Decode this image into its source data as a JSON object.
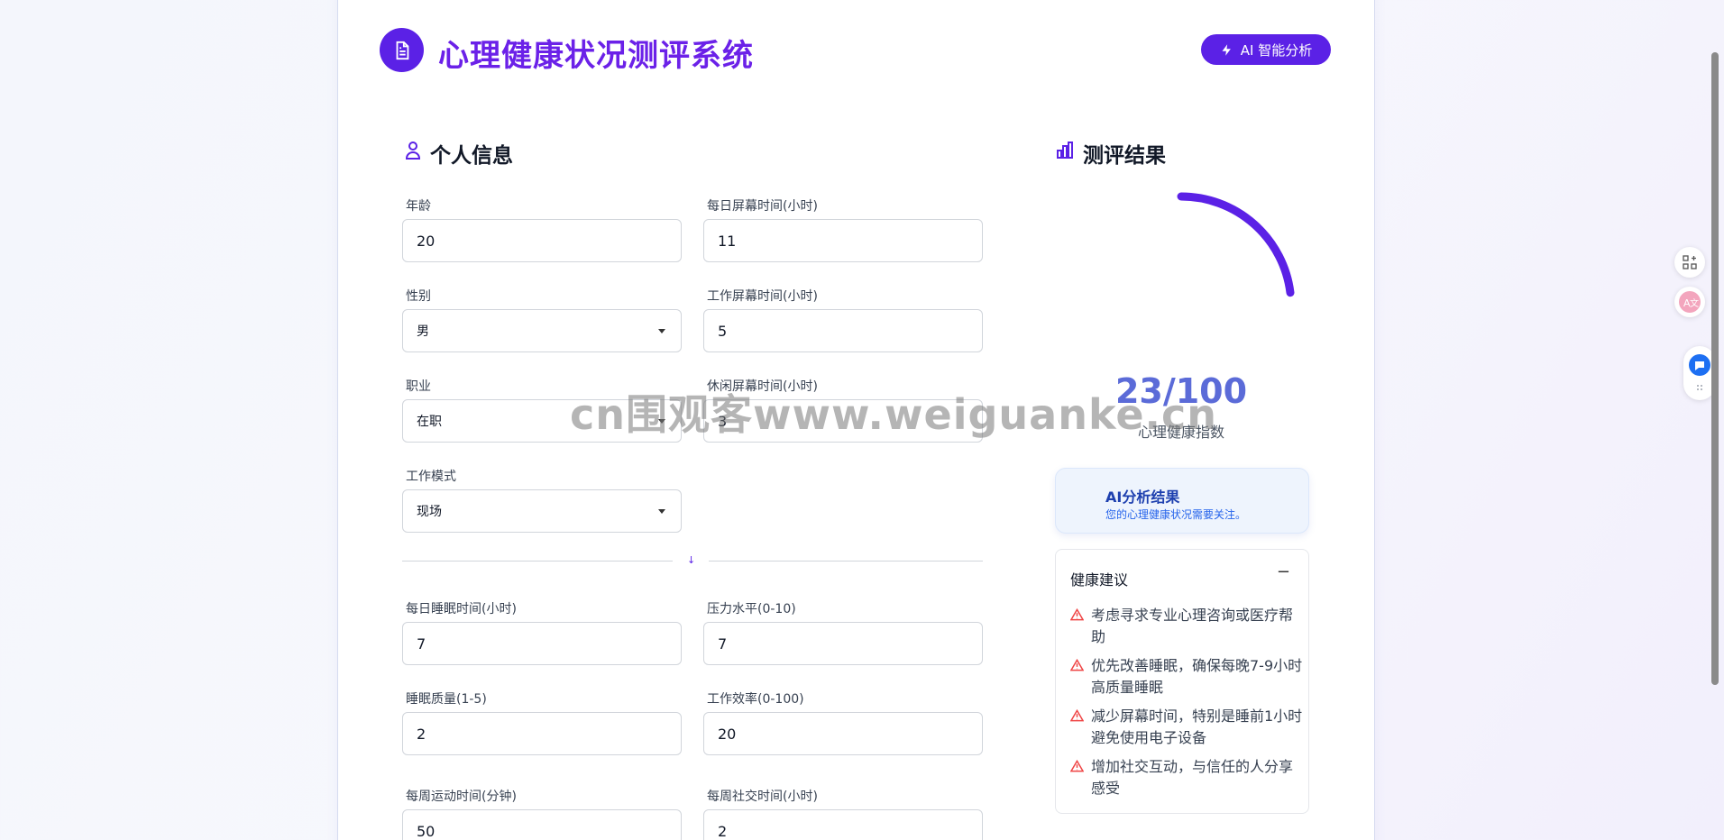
{
  "header": {
    "title": "心理健康状况测评系统",
    "ai_button_label": "AI 智能分析"
  },
  "personal_info": {
    "title": "个人信息",
    "fields": {
      "age": {
        "label": "年龄",
        "value": "20"
      },
      "daily_screen": {
        "label": "每日屏幕时间(小时)",
        "value": "11"
      },
      "gender": {
        "label": "性别",
        "value": "男"
      },
      "work_screen": {
        "label": "工作屏幕时间(小时)",
        "value": "5"
      },
      "occupation": {
        "label": "职业",
        "value": "在职"
      },
      "leisure_screen": {
        "label": "休闲屏幕时间(小时)",
        "value": "3"
      },
      "work_mode": {
        "label": "工作模式",
        "value": "现场"
      },
      "sleep_hours": {
        "label": "每日睡眠时间(小时)",
        "value": "7"
      },
      "stress": {
        "label": "压力水平(0-10)",
        "value": "7"
      },
      "sleep_quality": {
        "label": "睡眠质量(1-5)",
        "value": "2"
      },
      "work_efficiency": {
        "label": "工作效率(0-100)",
        "value": "20"
      },
      "exercise": {
        "label": "每周运动时间(分钟)",
        "value": "50"
      },
      "social": {
        "label": "每周社交时间(小时)",
        "value": "2"
      }
    },
    "divider_mark": "↓"
  },
  "results": {
    "title": "测评结果",
    "score_text": "23/100",
    "score_value": 23,
    "score_max": 100,
    "score_label": "心理健康指数",
    "ai_result_title": "AI分析结果",
    "ai_result_text": "您的心理健康状况需要关注。",
    "advice_title": "健康建议",
    "advice_toggle": "−",
    "advice": [
      "考虑寻求专业心理咨询或医疗帮助",
      "优先改善睡眠，确保每晚7-9小时高质量睡眠",
      "减少屏幕时间，特别是睡前1小时避免使用电子设备",
      "增加社交互动，与信任的人分享感受"
    ]
  },
  "watermark": "cn围观客www.weiguanke.cn",
  "colors": {
    "accent": "#5b21e6",
    "title": "#6b21e8",
    "score": "#5b6bd8",
    "warning": "#ef4444"
  }
}
